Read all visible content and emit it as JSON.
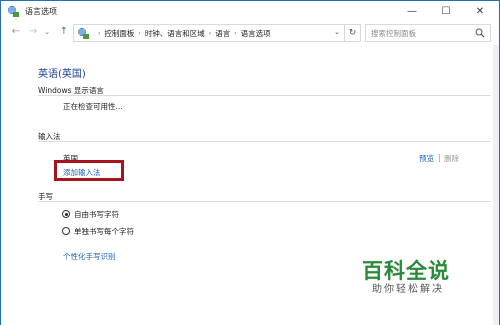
{
  "window": {
    "title": "语言选项",
    "controls": {
      "minimize": "—",
      "maximize": "☐",
      "close": "✕"
    }
  },
  "navigation": {
    "back": "←",
    "forward": "→",
    "recent": "⌄",
    "up": "↑",
    "breadcrumbs": [
      "控制面板",
      "时钟、语言和区域",
      "语言",
      "语言选项"
    ],
    "separator": "›",
    "refresh": "↻",
    "search_placeholder": "搜索控制面板"
  },
  "content": {
    "language_title": "英语(英国)",
    "display_language": {
      "heading": "Windows 显示语言",
      "status": "正在检查可用性..."
    },
    "input_method": {
      "heading": "输入法",
      "items": [
        {
          "name": "英国",
          "preview": "预览",
          "divider": "|",
          "remove": "删除"
        }
      ],
      "add_link": "添加输入法"
    },
    "handwriting": {
      "heading": "手写",
      "options": [
        {
          "label": "自由书写字符",
          "selected": true
        },
        {
          "label": "单独书写每个字符",
          "selected": false
        }
      ],
      "personalize_link": "个性化手写识别"
    }
  },
  "watermark": {
    "main": "百科全说",
    "sub": "助你轻松解决"
  },
  "colors": {
    "link": "#1a5fb4",
    "title_blue": "#1e3c96",
    "highlight_border": "#a6151d",
    "watermark_green": "#2a8a3a"
  }
}
